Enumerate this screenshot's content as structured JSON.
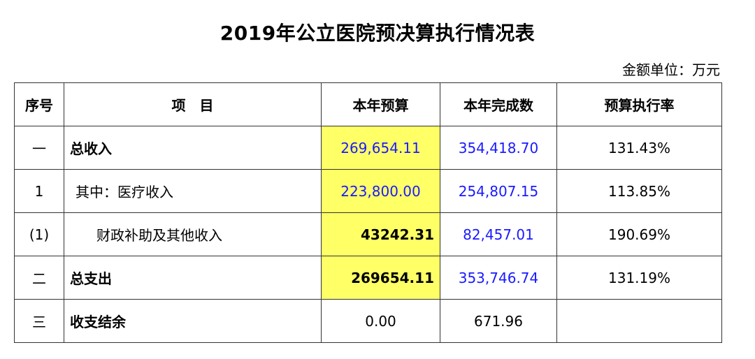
{
  "title": "2019年公立医院预决算执行情况表",
  "unit": "金额单位：万元",
  "headers": [
    "序号",
    "项　目",
    "本年预算",
    "本年完成数",
    "预算执行率"
  ],
  "rows": [
    {
      "seq": "一",
      "item": "总收入",
      "budget": "269,654.11",
      "done": "354,418.70",
      "rate": "131.43%"
    },
    {
      "seq": "1",
      "item": "其中：医疗收入",
      "budget": "223,800.00",
      "done": "254,807.15",
      "rate": "113.85%"
    },
    {
      "seq": "(1)",
      "item": "财政补助及其他收入",
      "budget": "43242.31",
      "done": "82,457.01",
      "rate": "190.69%"
    },
    {
      "seq": "二",
      "item": "总支出",
      "budget": "269654.11",
      "done": "353,746.74",
      "rate": "131.19%"
    },
    {
      "seq": "三",
      "item": "收支结余",
      "budget": "0.00",
      "done": "671.96",
      "rate": ""
    }
  ],
  "colors": {
    "highlight": "#ffff66",
    "blue_value": "#1a1aff",
    "border": "#333333"
  }
}
